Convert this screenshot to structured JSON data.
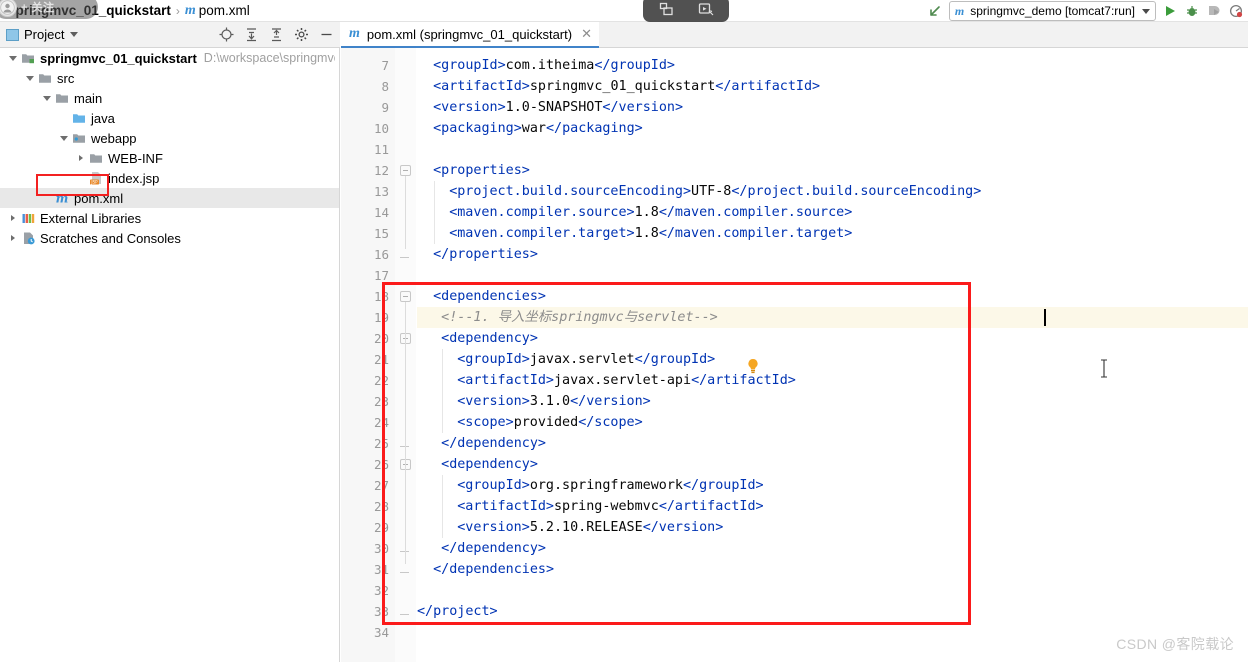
{
  "breadcrumb": {
    "project_name": "springmvc_01_quickstart",
    "separator": "›",
    "file_icon": "m",
    "file_name": "pom.xml"
  },
  "overlay": {
    "follow_badge_text": "+ 关注",
    "capture_widget": {
      "snapshot_icon": "snapshot-icon",
      "record_icon": "record-video-icon"
    }
  },
  "toolbar": {
    "back_arrow_icon": "back-arrow-icon",
    "run_config": {
      "icon": "m",
      "label": "springmvc_demo [tomcat7:run]",
      "dropdown_icon": "chevron-down-icon"
    },
    "run_button": "run-icon",
    "debug_button": "debug-icon",
    "run_coverage_button": "run-with-coverage-icon",
    "profiler_button": "profiler-icon"
  },
  "project_panel": {
    "title": "Project",
    "dropdown_icon": "chevron-down-icon",
    "icons": [
      {
        "name": "locate-icon"
      },
      {
        "name": "expand-all-icon"
      },
      {
        "name": "collapse-all-icon"
      },
      {
        "name": "gear-icon"
      },
      {
        "name": "minimize-icon"
      }
    ],
    "tree": [
      {
        "depth": 0,
        "twisty": "open",
        "icon": "module-icon",
        "label": "springmvc_01_quickstart",
        "bold": true,
        "path": "D:\\workspace\\springmvc\\s",
        "selected": false
      },
      {
        "depth": 1,
        "twisty": "open",
        "icon": "folder-icon",
        "label": "src",
        "bold": false,
        "path": "",
        "selected": false
      },
      {
        "depth": 2,
        "twisty": "open",
        "icon": "folder-icon",
        "label": "main",
        "bold": false,
        "path": "",
        "selected": false
      },
      {
        "depth": 3,
        "twisty": "none",
        "icon": "source-folder-icon",
        "label": "java",
        "bold": false,
        "path": "",
        "selected": false
      },
      {
        "depth": 3,
        "twisty": "open",
        "icon": "webapp-folder-icon",
        "label": "webapp",
        "bold": false,
        "path": "",
        "selected": false
      },
      {
        "depth": 4,
        "twisty": "closed",
        "icon": "folder-icon",
        "label": "WEB-INF",
        "bold": false,
        "path": "",
        "selected": false
      },
      {
        "depth": 4,
        "twisty": "none",
        "icon": "jsp-file-icon",
        "label": "index.jsp",
        "bold": false,
        "path": "",
        "selected": false
      },
      {
        "depth": 2,
        "twisty": "none",
        "icon": "maven-file-icon",
        "label": "pom.xml",
        "bold": false,
        "path": "",
        "selected": true
      },
      {
        "depth": 0,
        "twisty": "closed",
        "icon": "libraries-icon",
        "label": "External Libraries",
        "bold": false,
        "path": "",
        "selected": false
      },
      {
        "depth": 0,
        "twisty": "closed",
        "icon": "scratches-icon",
        "label": "Scratches and Consoles",
        "bold": false,
        "path": "",
        "selected": false
      }
    ]
  },
  "editor": {
    "tab": {
      "icon": "m",
      "label": "pom.xml (springmvc_01_quickstart)",
      "close_icon": "close-icon"
    },
    "first_line_number": 7,
    "lines": [
      {
        "n": 7,
        "indent": 2,
        "segments": [
          {
            "c": "tag",
            "t": "<groupId>"
          },
          {
            "c": "txt",
            "t": "com.itheima"
          },
          {
            "c": "tag",
            "t": "</groupId>"
          }
        ]
      },
      {
        "n": 8,
        "indent": 2,
        "segments": [
          {
            "c": "tag",
            "t": "<artifactId>"
          },
          {
            "c": "txt",
            "t": "springmvc_01_quickstart"
          },
          {
            "c": "tag",
            "t": "</artifactId>"
          }
        ]
      },
      {
        "n": 9,
        "indent": 2,
        "segments": [
          {
            "c": "tag",
            "t": "<version>"
          },
          {
            "c": "txt",
            "t": "1.0-SNAPSHOT"
          },
          {
            "c": "tag",
            "t": "</version>"
          }
        ]
      },
      {
        "n": 10,
        "indent": 2,
        "segments": [
          {
            "c": "tag",
            "t": "<packaging>"
          },
          {
            "c": "txt",
            "t": "war"
          },
          {
            "c": "tag",
            "t": "</packaging>"
          }
        ]
      },
      {
        "n": 11,
        "indent": 0,
        "segments": []
      },
      {
        "n": 12,
        "indent": 2,
        "segments": [
          {
            "c": "tag",
            "t": "<properties>"
          }
        ]
      },
      {
        "n": 13,
        "indent": 4,
        "segments": [
          {
            "c": "tag",
            "t": "<project.build.sourceEncoding>"
          },
          {
            "c": "txt",
            "t": "UTF-8"
          },
          {
            "c": "tag",
            "t": "</project.build.sourceEncoding>"
          }
        ]
      },
      {
        "n": 14,
        "indent": 4,
        "segments": [
          {
            "c": "tag",
            "t": "<maven.compiler.source>"
          },
          {
            "c": "txt",
            "t": "1.8"
          },
          {
            "c": "tag",
            "t": "</maven.compiler.source>"
          }
        ]
      },
      {
        "n": 15,
        "indent": 4,
        "segments": [
          {
            "c": "tag",
            "t": "<maven.compiler.target>"
          },
          {
            "c": "txt",
            "t": "1.8"
          },
          {
            "c": "tag",
            "t": "</maven.compiler.target>"
          }
        ]
      },
      {
        "n": 16,
        "indent": 2,
        "segments": [
          {
            "c": "tag",
            "t": "</properties>"
          }
        ]
      },
      {
        "n": 17,
        "indent": 0,
        "segments": []
      },
      {
        "n": 18,
        "indent": 2,
        "segments": [
          {
            "c": "tag",
            "t": "<dependencies>"
          }
        ]
      },
      {
        "n": 19,
        "indent": 3,
        "segments": [
          {
            "c": "cmt",
            "t": "<!--1. 导入坐标springmvc与servlet-->"
          }
        ]
      },
      {
        "n": 20,
        "indent": 3,
        "segments": [
          {
            "c": "tag",
            "t": "<dependency>"
          }
        ]
      },
      {
        "n": 21,
        "indent": 5,
        "segments": [
          {
            "c": "tag",
            "t": "<groupId>"
          },
          {
            "c": "txt",
            "t": "javax.servlet"
          },
          {
            "c": "tag",
            "t": "</groupId>"
          }
        ]
      },
      {
        "n": 22,
        "indent": 5,
        "segments": [
          {
            "c": "tag",
            "t": "<artifactId>"
          },
          {
            "c": "txt",
            "t": "javax.servlet-api"
          },
          {
            "c": "tag",
            "t": "</artifactId>"
          }
        ]
      },
      {
        "n": 23,
        "indent": 5,
        "segments": [
          {
            "c": "tag",
            "t": "<version>"
          },
          {
            "c": "txt",
            "t": "3.1.0"
          },
          {
            "c": "tag",
            "t": "</version>"
          }
        ]
      },
      {
        "n": 24,
        "indent": 5,
        "segments": [
          {
            "c": "tag",
            "t": "<scope>"
          },
          {
            "c": "txt",
            "t": "provided"
          },
          {
            "c": "tag",
            "t": "</scope>"
          }
        ]
      },
      {
        "n": 25,
        "indent": 3,
        "segments": [
          {
            "c": "tag",
            "t": "</dependency>"
          }
        ]
      },
      {
        "n": 26,
        "indent": 3,
        "segments": [
          {
            "c": "tag",
            "t": "<dependency>"
          }
        ]
      },
      {
        "n": 27,
        "indent": 5,
        "segments": [
          {
            "c": "tag",
            "t": "<groupId>"
          },
          {
            "c": "txt",
            "t": "org.springframework"
          },
          {
            "c": "tag",
            "t": "</groupId>"
          }
        ]
      },
      {
        "n": 28,
        "indent": 5,
        "segments": [
          {
            "c": "tag",
            "t": "<artifactId>"
          },
          {
            "c": "txt",
            "t": "spring-webmvc"
          },
          {
            "c": "tag",
            "t": "</artifactId>"
          }
        ]
      },
      {
        "n": 29,
        "indent": 5,
        "segments": [
          {
            "c": "tag",
            "t": "<version>"
          },
          {
            "c": "txt",
            "t": "5.2.10.RELEASE"
          },
          {
            "c": "tag",
            "t": "</version>"
          }
        ]
      },
      {
        "n": 30,
        "indent": 3,
        "segments": [
          {
            "c": "tag",
            "t": "</dependency>"
          }
        ]
      },
      {
        "n": 31,
        "indent": 2,
        "segments": [
          {
            "c": "tag",
            "t": "</dependencies>"
          }
        ]
      },
      {
        "n": 32,
        "indent": 0,
        "segments": []
      },
      {
        "n": 33,
        "indent": 0,
        "segments": [
          {
            "c": "tag",
            "t": "</project>"
          }
        ]
      },
      {
        "n": 34,
        "indent": 0,
        "segments": []
      }
    ],
    "caret_line": 19,
    "intention_bulb": "intention-bulb-icon"
  },
  "annotations": {
    "highlight_color": "#fb1a1a",
    "pom_tree_box": "red-rectangle-pom-xml",
    "dependencies_box": "red-rectangle-dependencies"
  },
  "watermark": "CSDN @客院载论"
}
